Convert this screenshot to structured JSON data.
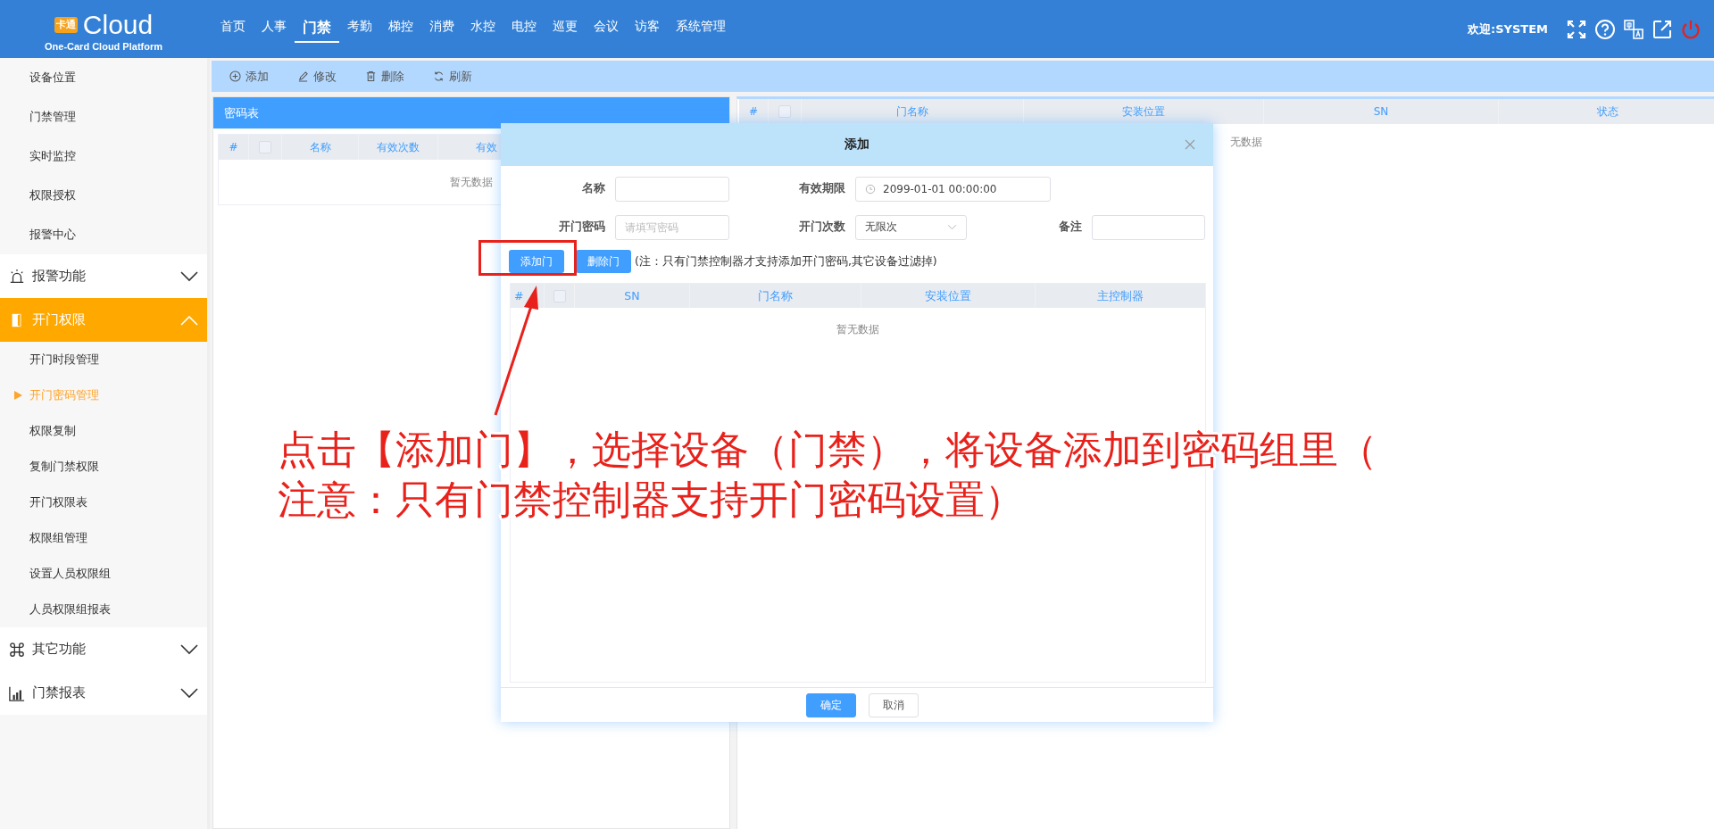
{
  "header": {
    "logo_badge": "卡通",
    "logo_text": "Cloud",
    "subtitle": "One-Card Cloud Platform",
    "nav": [
      {
        "label": "首页",
        "selected": false
      },
      {
        "label": "人事",
        "selected": false
      },
      {
        "label": "门禁",
        "selected": true
      },
      {
        "label": "考勤",
        "selected": false
      },
      {
        "label": "梯控",
        "selected": false
      },
      {
        "label": "消费",
        "selected": false
      },
      {
        "label": "水控",
        "selected": false
      },
      {
        "label": "电控",
        "selected": false
      },
      {
        "label": "巡更",
        "selected": false
      },
      {
        "label": "会议",
        "selected": false
      },
      {
        "label": "访客",
        "selected": false
      },
      {
        "label": "系统管理",
        "selected": false
      }
    ],
    "welcome": "欢迎:SYSTEM"
  },
  "sidebar": {
    "top_items": [
      "设备位置",
      "门禁管理",
      "实时监控",
      "权限授权",
      "报警中心"
    ],
    "groups": [
      {
        "label": "报警功能",
        "expanded": false,
        "selected": false
      },
      {
        "label": "开门权限",
        "expanded": true,
        "selected": true,
        "children": [
          {
            "label": "开门时段管理",
            "selected": false
          },
          {
            "label": "开门密码管理",
            "selected": true
          },
          {
            "label": "权限复制",
            "selected": false
          },
          {
            "label": "复制门禁权限",
            "selected": false
          },
          {
            "label": "开门权限表",
            "selected": false
          },
          {
            "label": "权限组管理",
            "selected": false
          },
          {
            "label": "设置人员权限组",
            "selected": false
          },
          {
            "label": "人员权限组报表",
            "selected": false
          }
        ]
      },
      {
        "label": "其它功能",
        "expanded": false,
        "selected": false
      },
      {
        "label": "门禁报表",
        "expanded": false,
        "selected": false
      }
    ]
  },
  "toolbar": [
    "添加",
    "修改",
    "删除",
    "刷新"
  ],
  "left_panel": {
    "title": "密码表",
    "table": {
      "columns": [
        "#",
        "名称",
        "有效次数",
        "有效"
      ],
      "select_all_checked": false,
      "empty_text": "暂无数据"
    }
  },
  "right_panel": {
    "table": {
      "columns": [
        "#",
        "门名称",
        "安装位置",
        "SN",
        "状态"
      ],
      "select_all_checked": false,
      "empty_text": "无数据"
    }
  },
  "dialog": {
    "title": "添加",
    "form_rows": [
      [
        {
          "label": "名称",
          "kind": "text"
        },
        {
          "label": "有效期限",
          "kind": "date",
          "value": "2099-01-01 00:00:00"
        }
      ],
      [
        {
          "label": "开门密码",
          "kind": "text",
          "placeholder": "请填写密码"
        },
        {
          "label": "开门次数",
          "kind": "select",
          "value": "无限次"
        },
        {
          "label": "备注",
          "kind": "text"
        }
      ]
    ],
    "actions": [
      "添加门",
      "删除门"
    ],
    "note": "(注：只有门禁控制器才支持添加开门密码,其它设备过滤掉)",
    "table": {
      "columns": [
        "#",
        "SN",
        "门名称",
        "安装位置",
        "主控制器"
      ],
      "select_all_checked": false,
      "empty_text": "暂无数据"
    },
    "footer_buttons": [
      {
        "label": "确定",
        "primary": true
      },
      {
        "label": "取消",
        "primary": false
      }
    ]
  },
  "annotation": {
    "lines": [
      "点击【添加门】，选择设备（门禁），将设备添加到密码组里（",
      "注意：只有门禁控制器支持开门密码设置）"
    ]
  }
}
